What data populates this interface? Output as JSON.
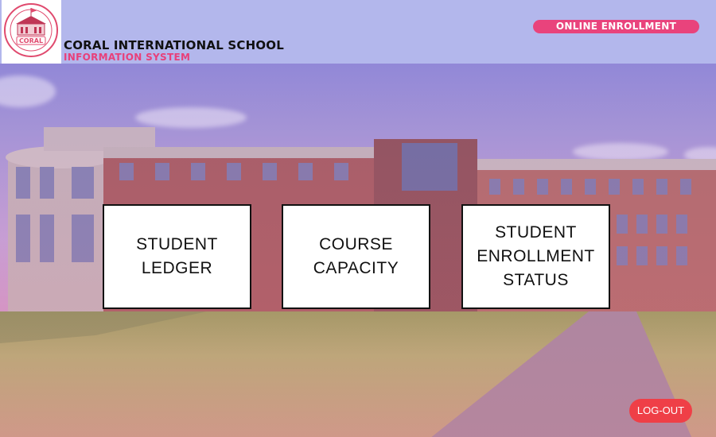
{
  "header": {
    "logo_text": "CORAL",
    "logo_subtext": "INTERNATIONAL SCHOOL",
    "school_name": "CORAL INTERNATIONAL SCHOOL",
    "system_name": "INFORMATION SYSTEM",
    "badge": "ONLINE ENROLLMENT"
  },
  "menu": {
    "items": [
      {
        "label": "STUDENT\nLEDGER"
      },
      {
        "label": "COURSE\nCAPACITY"
      },
      {
        "label": "STUDENT\nENROLLMENT\nSTATUS"
      }
    ]
  },
  "footer": {
    "logout_label": "LOG-OUT"
  },
  "colors": {
    "accent": "#e9437c",
    "header_bg": "#b3b7ec",
    "logout": "#ef3f47"
  }
}
